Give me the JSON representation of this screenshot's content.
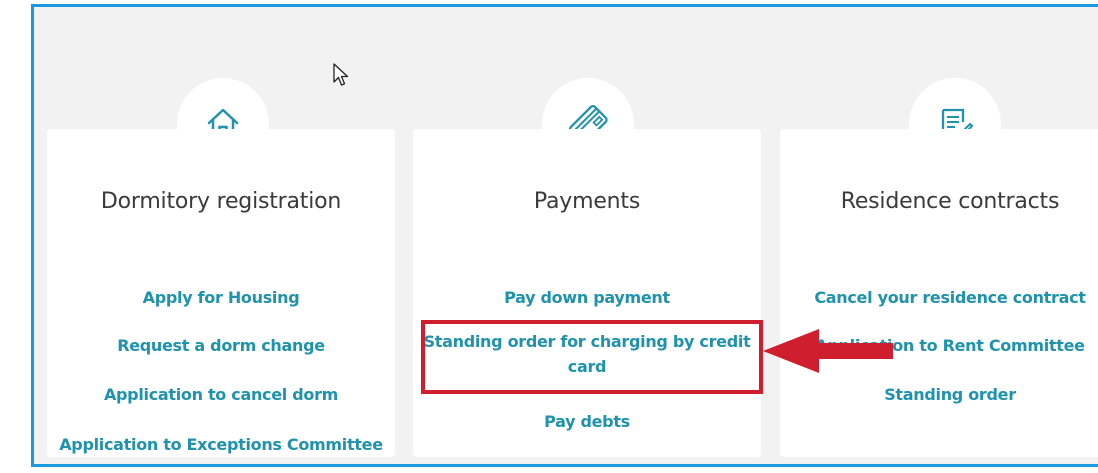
{
  "cards": [
    {
      "title": "Dormitory registration",
      "icon": "house-icon",
      "links": [
        "Apply for Housing",
        "Request a dorm change",
        "Application to cancel dorm",
        "Application to Exceptions Committee"
      ]
    },
    {
      "title": "Payments",
      "icon": "credit-card-icon",
      "links": [
        "Pay down payment",
        "Standing order for charging by credit card",
        "Pay debts"
      ]
    },
    {
      "title": "Residence contracts",
      "icon": "contract-edit-icon",
      "links": [
        "Cancel your residence contract",
        "Application to Rent Committee",
        "Standing order"
      ]
    }
  ],
  "colors": {
    "accent_border": "#1a9be0",
    "link": "#1f93ad",
    "highlight": "#cf1f2e",
    "icon": "#1f93ad"
  }
}
